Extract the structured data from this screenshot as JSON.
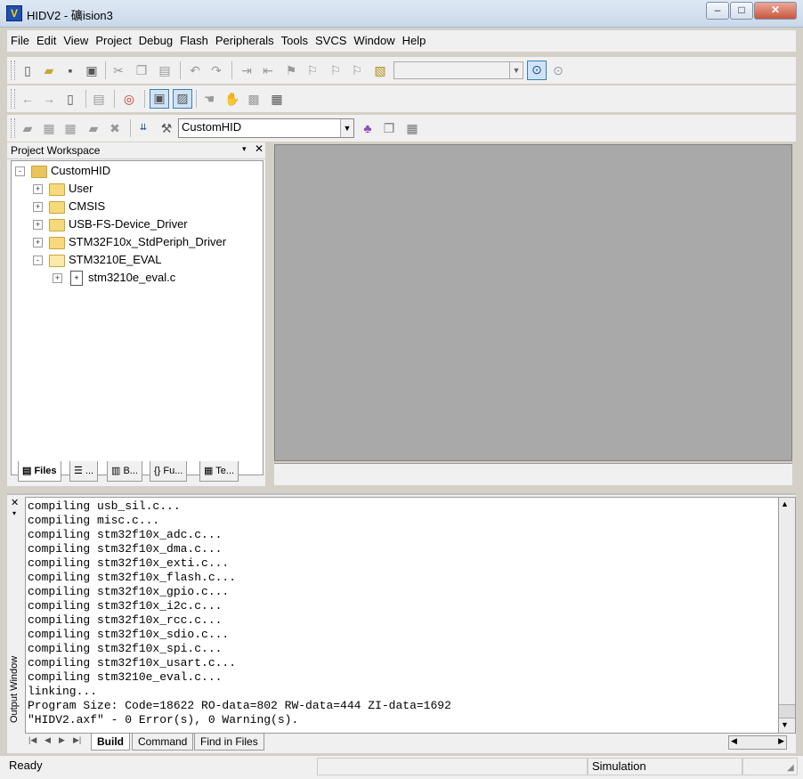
{
  "window": {
    "title": "HIDV2 - 礦ision3",
    "app_icon_glyph": "V"
  },
  "window_buttons": {
    "minimize": "–",
    "maximize": "□",
    "close": "✕"
  },
  "menubar": {
    "items": [
      "File",
      "Edit",
      "View",
      "Project",
      "Debug",
      "Flash",
      "Peripherals",
      "Tools",
      "SVCS",
      "Window",
      "Help"
    ]
  },
  "toolbar_build": {
    "target_select_value": "CustomHID"
  },
  "workspace": {
    "title": "Project Workspace",
    "tree": [
      {
        "label": "CustomHID",
        "expander": "-",
        "level": 0
      },
      {
        "label": "User",
        "expander": "+",
        "level": 1
      },
      {
        "label": "CMSIS",
        "expander": "+",
        "level": 1
      },
      {
        "label": "USB-FS-Device_Driver",
        "expander": "+",
        "level": 1
      },
      {
        "label": "STM32F10x_StdPeriph_Driver",
        "expander": "+",
        "level": 1
      },
      {
        "label": "STM3210E_EVAL",
        "expander": "-",
        "level": 1
      },
      {
        "label": "stm3210e_eval.c",
        "expander": "+",
        "level": 2
      }
    ],
    "tabs": [
      {
        "label": "Files",
        "icon": "files-icon"
      },
      {
        "label": "...",
        "icon": "registers-icon"
      },
      {
        "label": "B...",
        "icon": "books-icon"
      },
      {
        "label": "Fu...",
        "icon": "functions-icon"
      },
      {
        "label": "Te...",
        "icon": "templates-icon"
      }
    ]
  },
  "output": {
    "title": "Output Window",
    "lines": [
      "compiling usb_sil.c...",
      "compiling misc.c...",
      "compiling stm32f10x_adc.c...",
      "compiling stm32f10x_dma.c...",
      "compiling stm32f10x_exti.c...",
      "compiling stm32f10x_flash.c...",
      "compiling stm32f10x_gpio.c...",
      "compiling stm32f10x_i2c.c...",
      "compiling stm32f10x_rcc.c...",
      "compiling stm32f10x_sdio.c...",
      "compiling stm32f10x_spi.c...",
      "compiling stm32f10x_usart.c...",
      "compiling stm3210e_eval.c...",
      "linking...",
      "Program Size: Code=18622 RO-data=802 RW-data=444 ZI-data=1692",
      "\"HIDV2.axf\" - 0 Error(s), 0 Warning(s)."
    ],
    "tabs": [
      "Build",
      "Command",
      "Find in Files"
    ]
  },
  "statusbar": {
    "status": "Ready",
    "mode": "Simulation"
  }
}
